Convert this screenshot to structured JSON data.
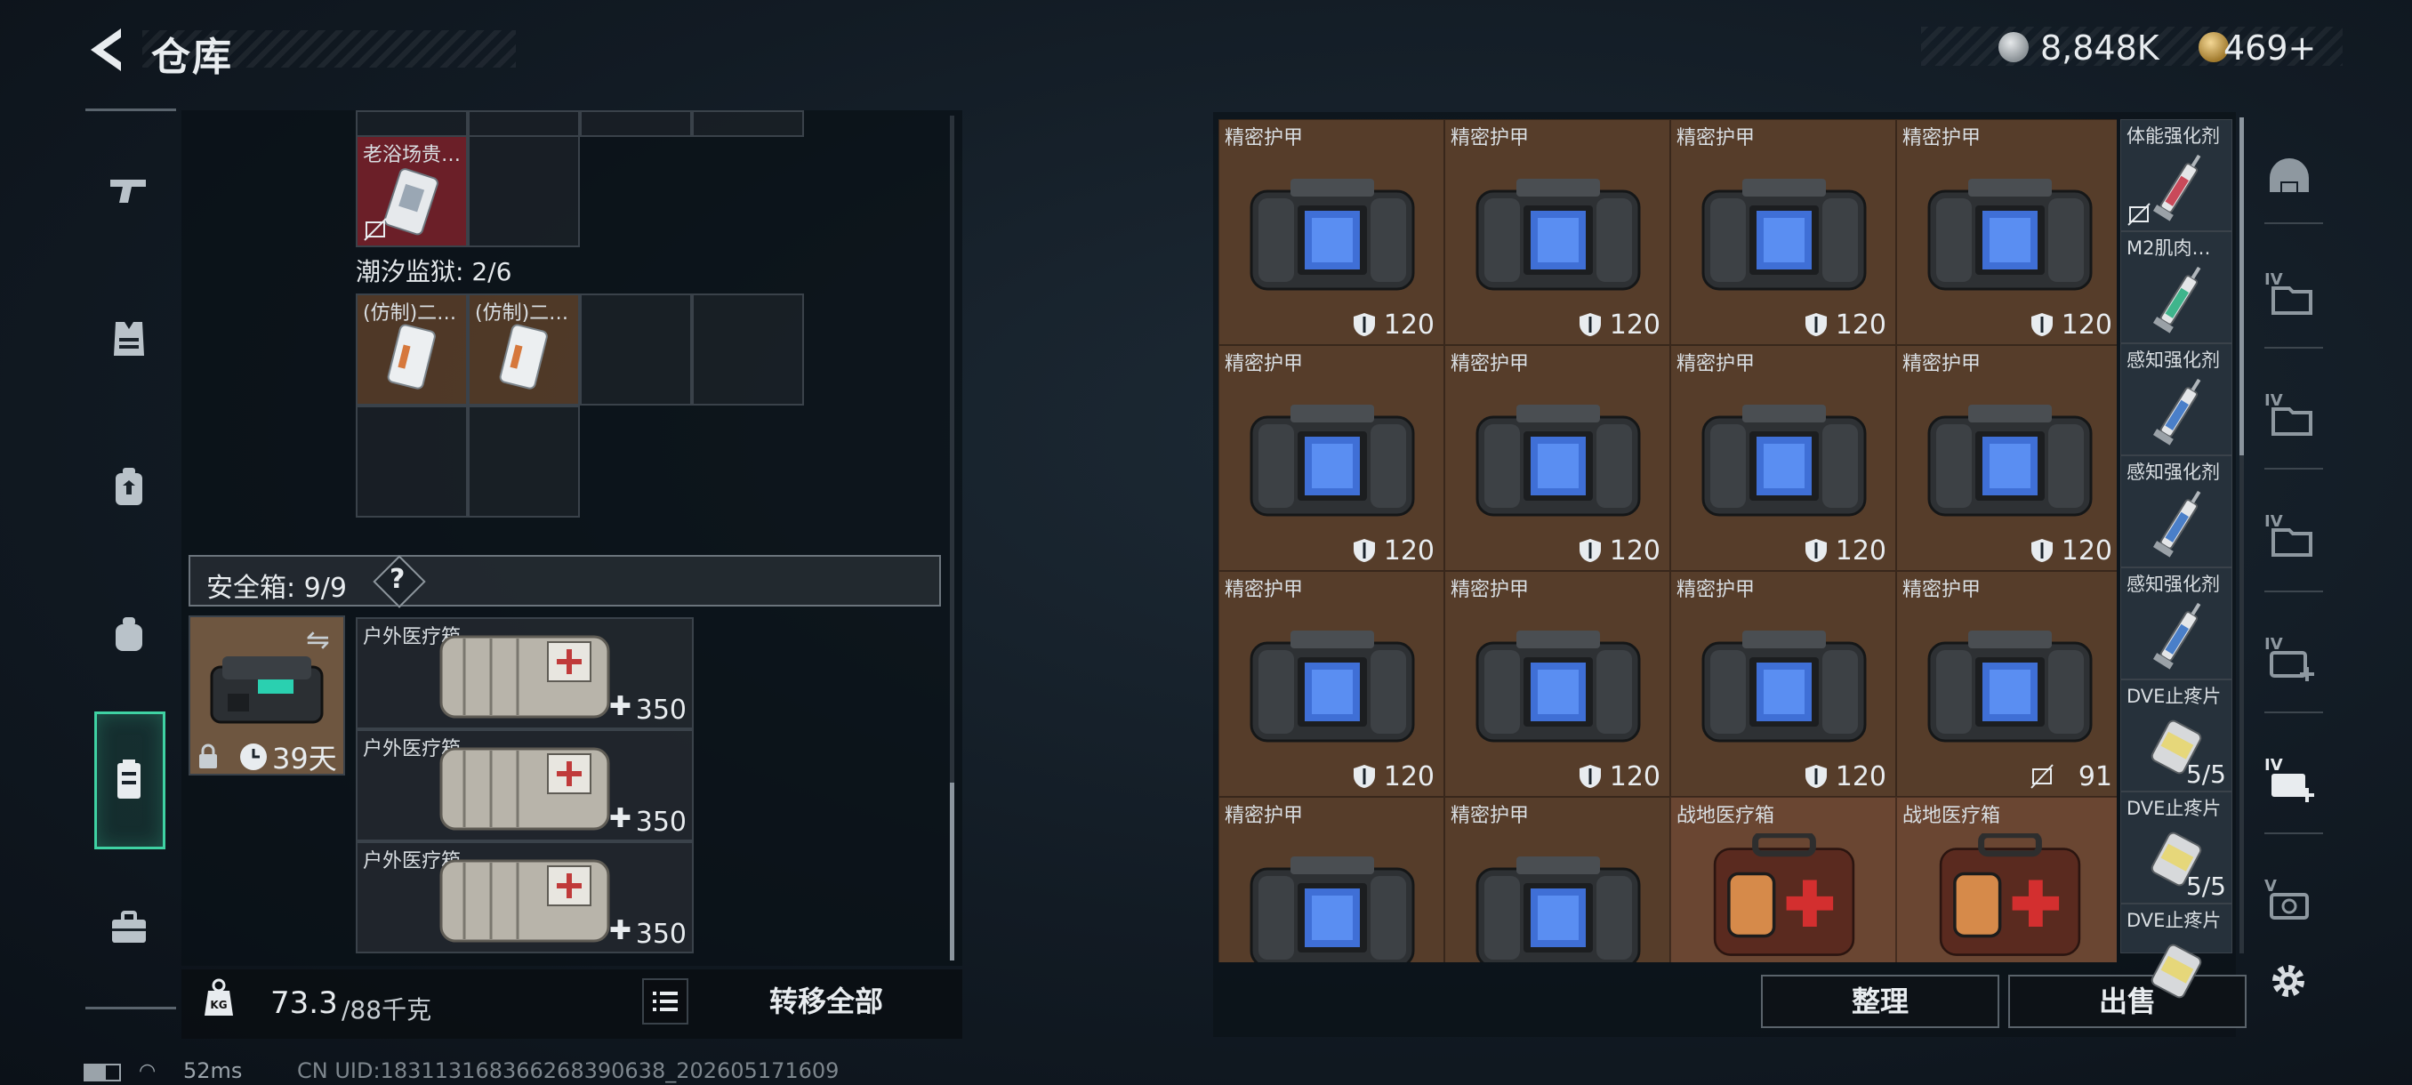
{
  "header": {
    "title": "仓库",
    "silver_amount": "8,848K",
    "gold_amount": "469+"
  },
  "left_rail": {
    "items": [
      "pistol-icon",
      "vest-icon",
      "backpack-icon",
      "pouch-icon",
      "safebox-icon",
      "toolbox-icon"
    ],
    "active_index": 4
  },
  "inventory": {
    "item_old_bathhouse": "老浴场贵…",
    "prison_label": "潮汐监狱: 2/6",
    "prison_items": [
      "(仿制)二…",
      "(仿制)二…"
    ]
  },
  "safebox": {
    "label": "安全箱: 9/9",
    "help": "?",
    "days": "39天",
    "items": [
      {
        "name": "户外医疗箱",
        "value": "350"
      },
      {
        "name": "户外医疗箱",
        "value": "350"
      },
      {
        "name": "户外医疗箱",
        "value": "350"
      }
    ]
  },
  "weight": {
    "current": "73.3",
    "unit": "/88千克"
  },
  "actions": {
    "transfer_all": "转移全部",
    "sort": "整理",
    "sell": "出售"
  },
  "stash": {
    "armor_rows": [
      [
        {
          "name": "精密护甲",
          "dur": "120",
          "tradable": true
        },
        {
          "name": "精密护甲",
          "dur": "120",
          "tradable": true
        },
        {
          "name": "精密护甲",
          "dur": "120",
          "tradable": true
        },
        {
          "name": "精密护甲",
          "dur": "120",
          "tradable": true
        }
      ],
      [
        {
          "name": "精密护甲",
          "dur": "120",
          "tradable": true
        },
        {
          "name": "精密护甲",
          "dur": "120",
          "tradable": true
        },
        {
          "name": "精密护甲",
          "dur": "120",
          "tradable": true
        },
        {
          "name": "精密护甲",
          "dur": "120",
          "tradable": true
        }
      ],
      [
        {
          "name": "精密护甲",
          "dur": "120",
          "tradable": true
        },
        {
          "name": "精密护甲",
          "dur": "120",
          "tradable": true
        },
        {
          "name": "精密护甲",
          "dur": "120",
          "tradable": true
        },
        {
          "name": "精密护甲",
          "dur": "91",
          "tradable": false
        }
      ],
      [
        {
          "name": "精密护甲",
          "dur": "",
          "tradable": true
        },
        {
          "name": "精密护甲",
          "dur": "",
          "tradable": true
        },
        {
          "name": "战地医疗箱",
          "dur": "",
          "tradable": true
        },
        {
          "name": "战地医疗箱",
          "dur": "",
          "tradable": true
        }
      ]
    ],
    "side_items": [
      {
        "name": "体能强化剂",
        "qty": "",
        "no_trade": true,
        "color": "#c94a5a"
      },
      {
        "name": "M2肌肉…",
        "qty": "",
        "no_trade": false,
        "color": "#3fb58c"
      },
      {
        "name": "感知强化剂",
        "qty": "",
        "no_trade": false,
        "color": "#4a7fc9"
      },
      {
        "name": "感知强化剂",
        "qty": "",
        "no_trade": false,
        "color": "#4a7fc9"
      },
      {
        "name": "感知强化剂",
        "qty": "",
        "no_trade": false,
        "color": "#4a7fc9"
      },
      {
        "name": "DVE止疼片",
        "qty": "5/5",
        "no_trade": false,
        "color": "#e6d77a"
      },
      {
        "name": "DVE止疼片",
        "qty": "5/5",
        "no_trade": false,
        "color": "#e6d77a"
      },
      {
        "name": "DVE止疼片",
        "qty": "",
        "no_trade": false,
        "color": "#e6d77a"
      }
    ]
  },
  "right_rail": [
    "helmet-icon",
    "folder-iv-icon",
    "folder-iv-icon",
    "folder-iv-icon",
    "medkit-iv-add-icon",
    "medkit-iv-add-icon",
    "camera-v-icon"
  ],
  "footer": {
    "ping": "52ms",
    "uid": "CN UID:183113168366268390638_202605171609"
  },
  "colors": {
    "accent": "#3fd2a3",
    "armor_bg": "#563d2a",
    "panel_bg": "#0a1016"
  }
}
